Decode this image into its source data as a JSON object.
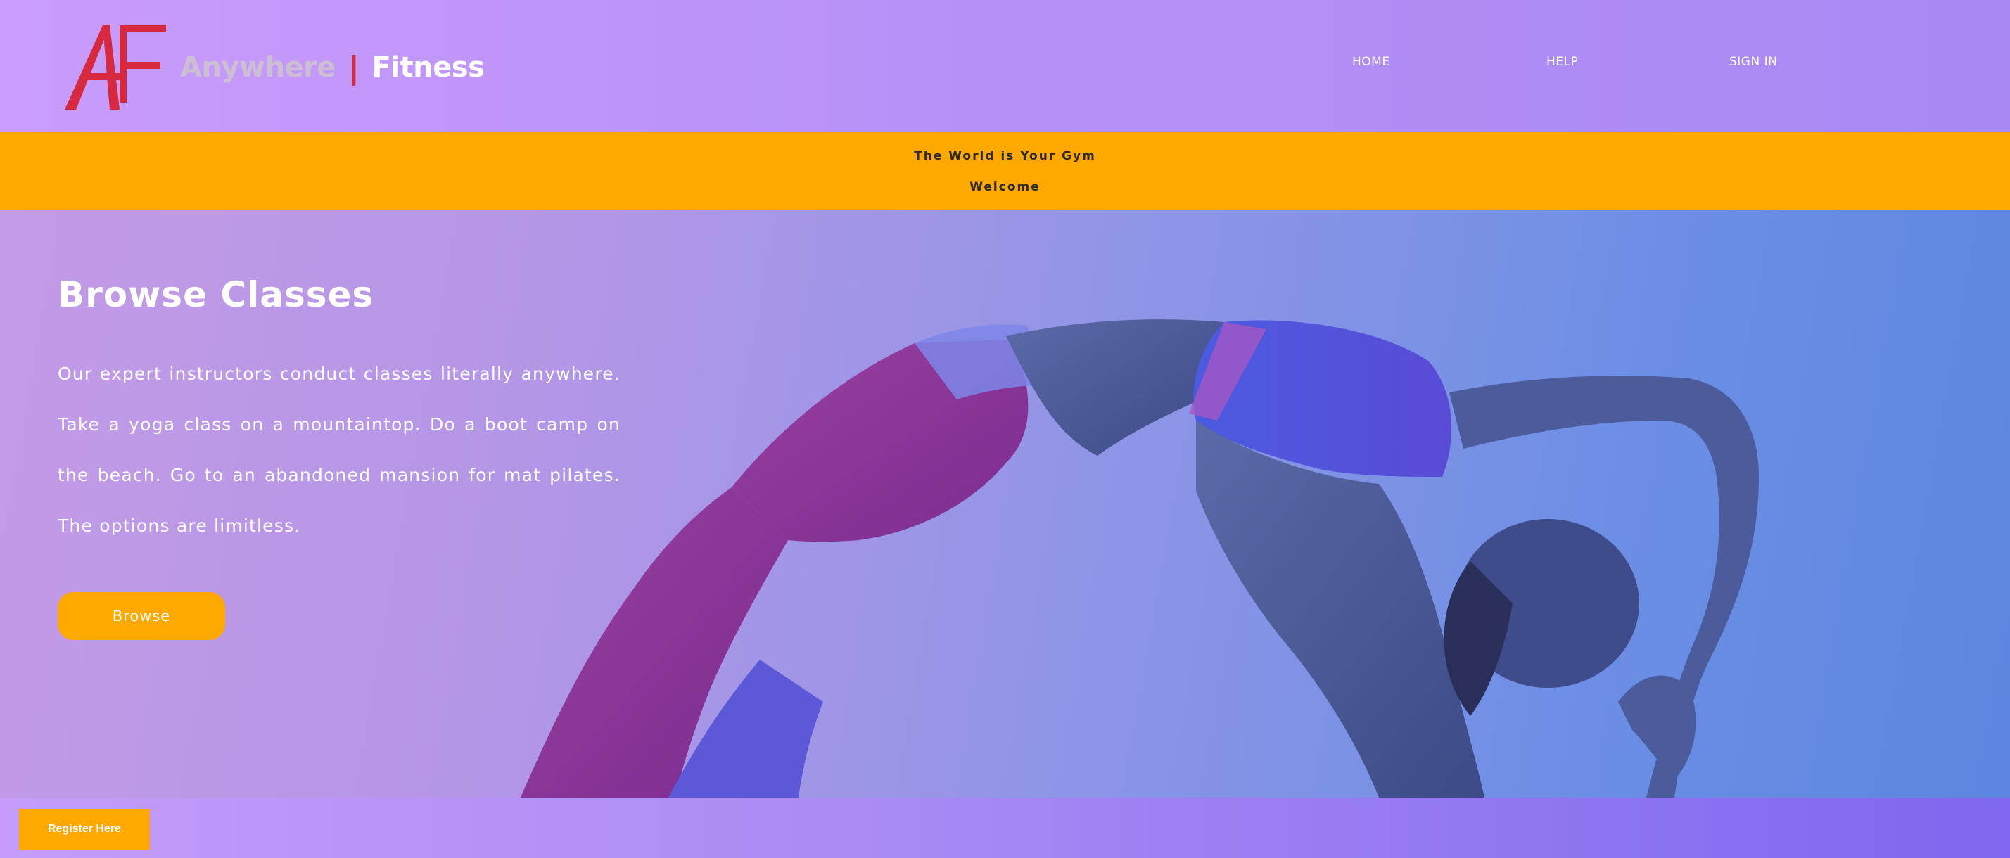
{
  "header": {
    "logo_alt": "AF",
    "brand_anywhere": "Anywhere",
    "brand_separator": "|",
    "brand_fitness": "Fitness",
    "nav": {
      "home": "HOME",
      "help": "HELP",
      "sign_in": "SIGN IN"
    }
  },
  "banner": {
    "line1": "The World is Your Gym",
    "line2": "Welcome"
  },
  "hero": {
    "title": "Browse Classes",
    "text": "Our expert instructors conduct classes literally anywhere. Take a yoga class on a mountaintop. Do a boot camp on the beach. Go to an abandoned mansion for mat pilates. The options are limitless.",
    "button": "Browse"
  },
  "footer": {
    "register_button": "Register Here"
  },
  "colors": {
    "accent_orange": "#ffa800",
    "logo_red": "#d6283f",
    "header_purple": "#c99cfb"
  }
}
